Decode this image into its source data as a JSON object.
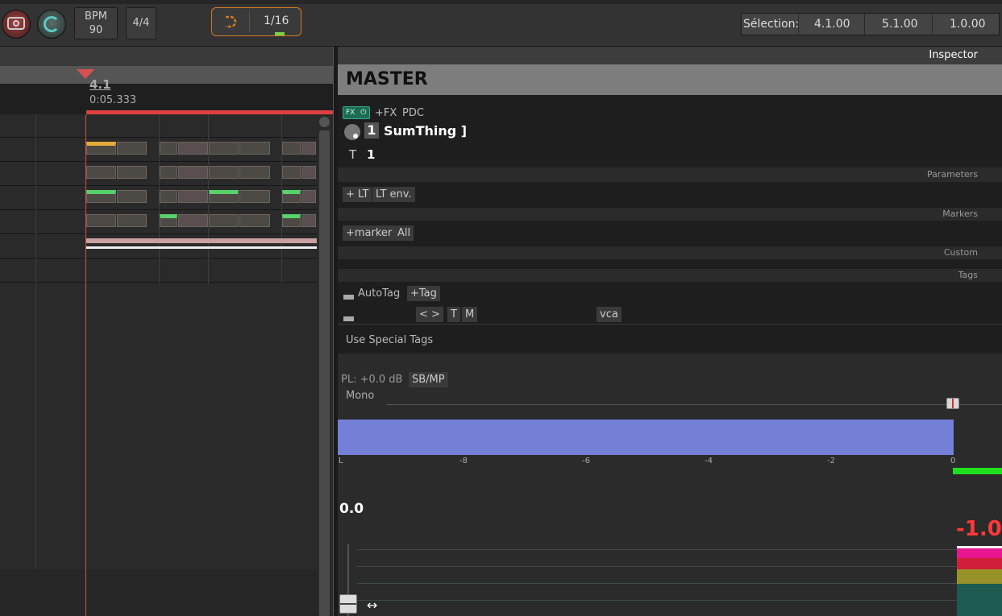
{
  "toolbar": {
    "bpm_label": "BPM",
    "bpm_value": "90",
    "time_signature": "4/4",
    "grid_value": "1/16",
    "selection_label": "Sélection:",
    "selection_start": "4.1.00",
    "selection_end": "5.1.00",
    "selection_length": "1.0.00",
    "icons": [
      "record-icon",
      "loop-icon",
      "snap-icon"
    ],
    "colors": {
      "grid_border": "#d67a24",
      "loop": "#5ec9c6"
    }
  },
  "arrange": {
    "position_bar": "4.1",
    "position_time": "0:05.333",
    "colors": {
      "playhead": "#d85050",
      "clip_yellow": "#e6ac3a",
      "clip_green": "#57d16b"
    }
  },
  "inspector": {
    "title": "Inspector",
    "track_name": "MASTER",
    "fx": {
      "fx_label": "FX",
      "add_fx": "+FX",
      "pdc": "PDC",
      "plugin_index": "1",
      "plugin_name": "SumThing ]",
      "t_label": "T",
      "t_value": "1"
    },
    "parameters": {
      "label": "Parameters",
      "add_lt": "+ LT",
      "lt_env": "LT env."
    },
    "markers": {
      "label": "Markers",
      "add_marker": "+marker",
      "all": "All"
    },
    "custom": {
      "label": "Custom"
    },
    "tags": {
      "label": "Tags",
      "autotag": "AutoTag",
      "add_tag": "+Tag",
      "prev_next": "< >",
      "t": "T",
      "m": "M",
      "vca": "vca",
      "special": "Use Special Tags"
    },
    "mixer": {
      "pan_law": "PL: +0.0 dB",
      "sb_mp": "SB/MP",
      "mono": "Mono",
      "ticks": [
        "L",
        "-8",
        "-6",
        "-4",
        "-2",
        "0"
      ],
      "fader_value": "0.0",
      "peak_value": "-1.0",
      "colors": {
        "level": "#7480d8",
        "meter": "#1ee01e",
        "peak": "#ff3838"
      }
    }
  }
}
